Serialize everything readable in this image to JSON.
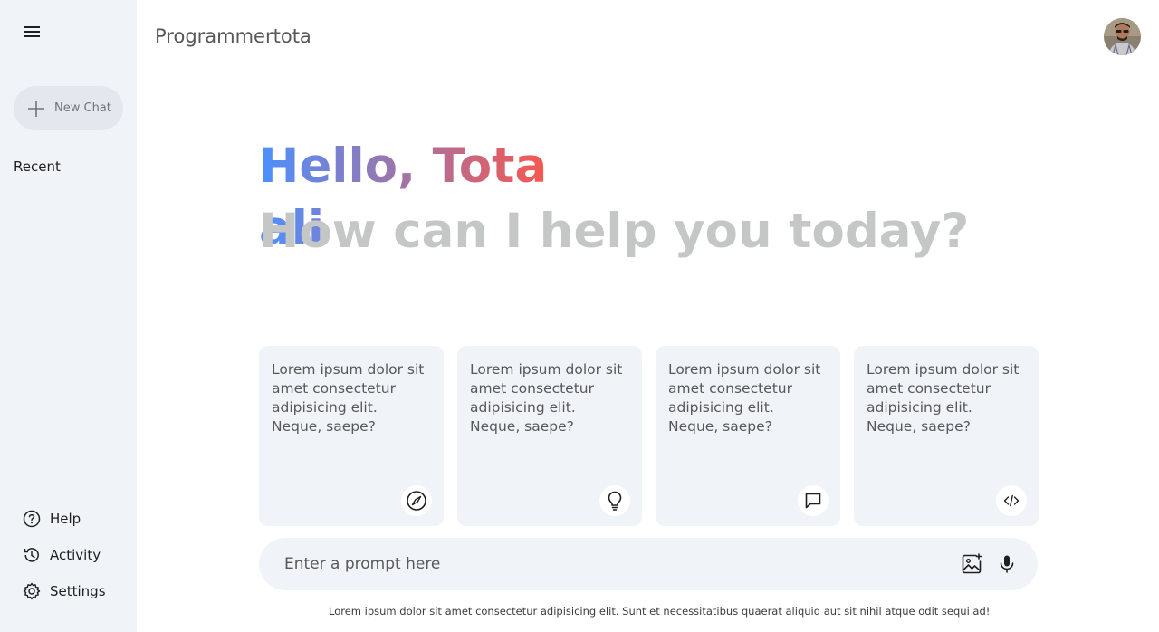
{
  "sidebar": {
    "menu_icon": "hamburger-menu-icon",
    "new_chat_label": "New Chat",
    "recent_label": "Recent",
    "bottom_items": [
      {
        "label": "Help",
        "icon": "help-circle-icon"
      },
      {
        "label": "Activity",
        "icon": "history-icon"
      },
      {
        "label": "Settings",
        "icon": "gear-icon"
      }
    ]
  },
  "header": {
    "title": "Programmertota"
  },
  "greeting": {
    "hello": "Hello, Tota ali",
    "subtitle": "How can I help you today?"
  },
  "cards": [
    {
      "text": "Lorem ipsum dolor sit amet consectetur adipisicing elit. Neque, saepe?",
      "icon": "compass-icon"
    },
    {
      "text": "Lorem ipsum dolor sit amet consectetur adipisicing elit. Neque, saepe?",
      "icon": "lightbulb-icon"
    },
    {
      "text": "Lorem ipsum dolor sit amet consectetur adipisicing elit. Neque, saepe?",
      "icon": "message-icon"
    },
    {
      "text": "Lorem ipsum dolor sit amet consectetur adipisicing elit. Neque, saepe?",
      "icon": "code-icon"
    }
  ],
  "prompt": {
    "placeholder": "Enter a prompt here",
    "value": ""
  },
  "footer": {
    "note": "Lorem ipsum dolor sit amet consectetur adipisicing elit. Sunt et necessitatibus quaerat aliquid aut sit nihil atque odit sequi ad!"
  },
  "colors": {
    "sidebar_bg": "#f0f4f9",
    "gradient_start": "#4b90ff",
    "gradient_end": "#ff5546",
    "subtitle": "#c4c7c5"
  }
}
